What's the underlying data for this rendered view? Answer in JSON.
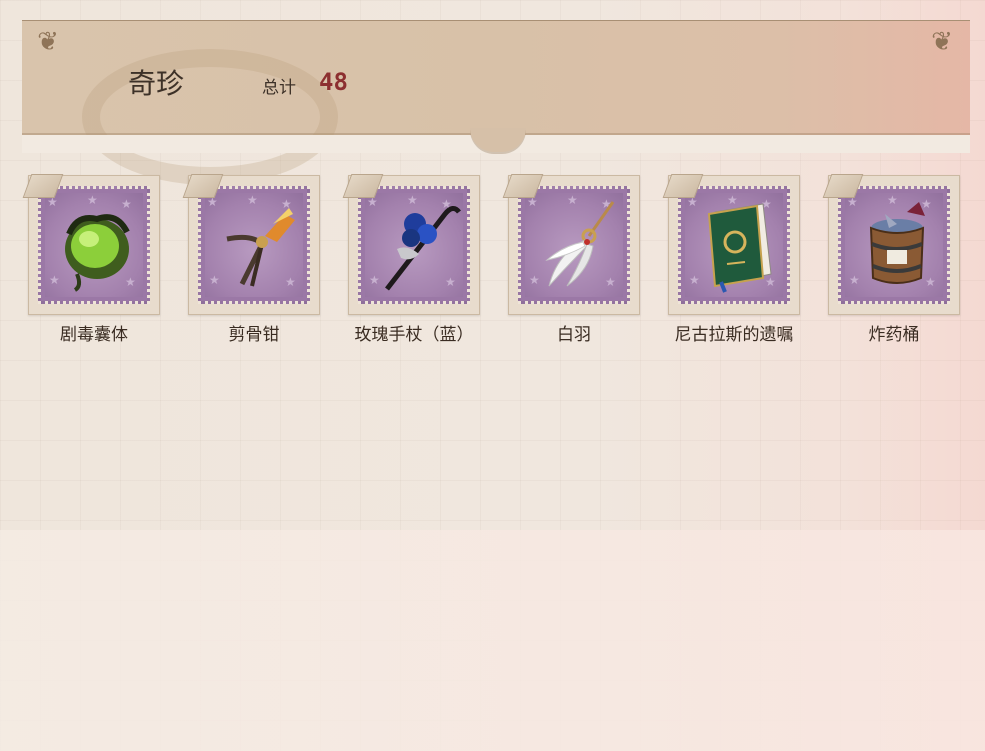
{
  "header": {
    "title": "奇珍",
    "total_label": "总计",
    "total_value": "48"
  },
  "items": [
    {
      "name": "剧毒囊体",
      "icon": "poison-sac-icon"
    },
    {
      "name": "剪骨钳",
      "icon": "bone-clipper-icon"
    },
    {
      "name": "玫瑰手杖（蓝）",
      "icon": "rose-cane-icon"
    },
    {
      "name": "白羽",
      "icon": "white-feather-icon"
    },
    {
      "name": "尼古拉斯的遗嘱",
      "icon": "will-book-icon"
    },
    {
      "name": "炸药桶",
      "icon": "powder-barrel-icon"
    }
  ],
  "colors": {
    "accent_total": "#8c2f30",
    "stamp_purple": "#a381ad"
  }
}
